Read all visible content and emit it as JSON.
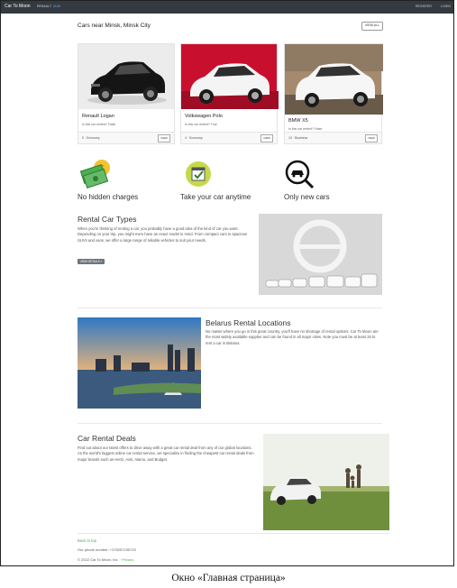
{
  "navbar": {
    "brand": "Car To Moon",
    "links": [
      "RENAULT",
      "AUDI"
    ],
    "right_links": [
      "REGISTER",
      "LOGIN"
    ]
  },
  "cars_section": {
    "heading": "Cars near Minsk, Minsk City",
    "view_all_label": "VIEW ALL"
  },
  "cars": [
    {
      "name": "Renault Logan",
      "rented_text": "Is this car rented? False",
      "seats": "5",
      "class": "Economy",
      "view_label": "VIEW"
    },
    {
      "name": "Volkswagen Polo",
      "rented_text": "Is this car rented? True",
      "seats": "4",
      "class": "Economy",
      "view_label": "VIEW"
    },
    {
      "name": "BMW X5",
      "rented_text": "Is this car rented? False",
      "seats": "10",
      "class": "Business",
      "view_label": "VIEW"
    }
  ],
  "features": [
    {
      "label": "No hidden charges",
      "icon": "money-icon"
    },
    {
      "label": "Take your car anytime",
      "icon": "calendar-check-icon"
    },
    {
      "label": "Only new cars",
      "icon": "new-car-search-icon"
    }
  ],
  "rental_types": {
    "title": "Rental Car Types",
    "text": "When you're thinking of renting a car, you probably have a good idea of the kind of car you want. Depending on your trip, you might even have an exact model in mind. From compact cars to spacious SUVs and vans, we offer a large range of reliable vehicles to suit your needs.",
    "button_label": "VIEW DETAILS »"
  },
  "belarus": {
    "title": "Belarus Rental Locations",
    "text": "No matter where you go in this great country, you'll have no shortage of rental options. Car To Moon are the most widely available supplier and can be found in all major cities. Note you must be at least 19 to rent a car in Belarus."
  },
  "deals": {
    "title": "Car Rental Deals",
    "text": "Find out about our latest offers to drive away with a great car rental deal from any of our global locations. As the world's biggest online car rental service, we specialize in finding the cheapest car rental deals from major brands such as Hertz, Avis, Alamo, and Budget."
  },
  "footer": {
    "back_to_top": "Back to top",
    "phone": "Our phone number: +375257195720",
    "copyright": "© 2022 Car To Moon, Inc. ·",
    "privacy": "Privacy"
  },
  "caption": "Окно «Главная страница»"
}
